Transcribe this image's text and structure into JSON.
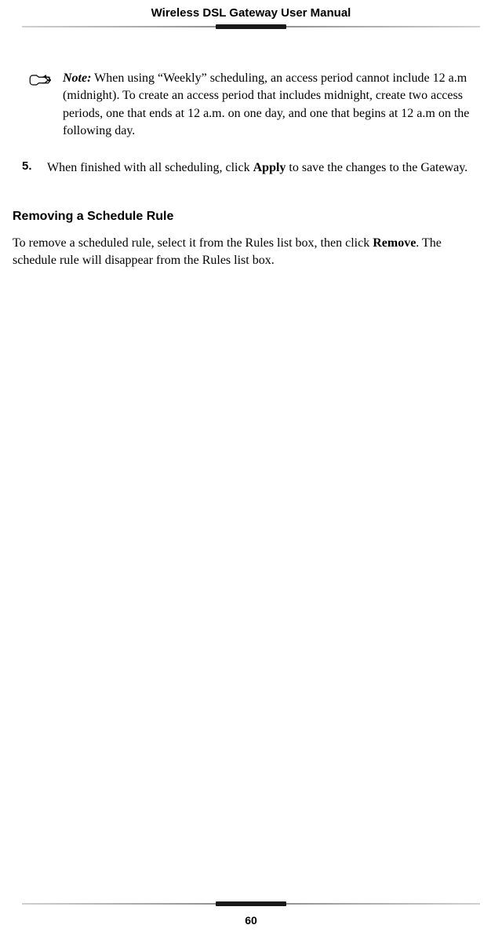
{
  "header": {
    "title": "Wireless DSL Gateway User Manual"
  },
  "note": {
    "label": "Note:",
    "text": " When using “Weekly” scheduling, an access period cannot include 12 a.m (midnight). To create an access period that includes midnight, create two access periods, one that ends at 12 a.m. on one day, and one that begins at 12 a.m on the following day."
  },
  "step": {
    "number": "5.",
    "text_before": "When finished with all scheduling, click ",
    "bold1": "Apply",
    "text_after": " to save the changes to the Gateway."
  },
  "section": {
    "heading": "Removing a Schedule Rule",
    "para_before": "To remove a scheduled rule, select it from the Rules list box, then click ",
    "bold1": "Remove",
    "para_after": ". The schedule rule will disappear from the Rules list box."
  },
  "footer": {
    "page_number": "60"
  }
}
